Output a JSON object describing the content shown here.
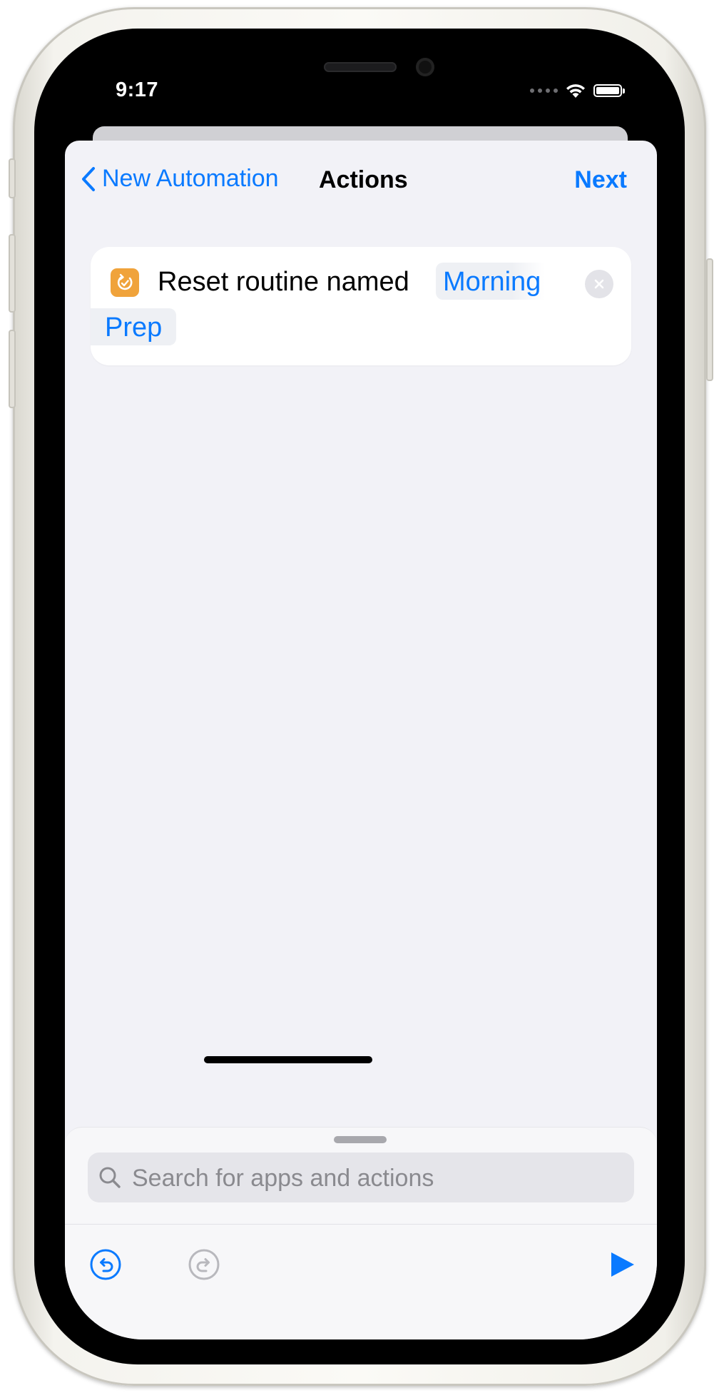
{
  "status_bar": {
    "time": "9:17"
  },
  "nav": {
    "back_label": "New Automation",
    "title": "Actions",
    "next_label": "Next"
  },
  "action": {
    "label": "Reset routine named",
    "routine_name_line1": "Morning",
    "routine_name_line2": "Prep",
    "icon": "routine-reset-icon"
  },
  "search": {
    "placeholder": "Search for apps and actions",
    "value": ""
  },
  "toolbar": {
    "undo_icon": "undo-icon",
    "redo_icon": "redo-icon",
    "run_icon": "play-icon"
  },
  "colors": {
    "accent": "#0A7AFF",
    "app_icon": "#F0A33B",
    "background": "#F2F2F7"
  }
}
